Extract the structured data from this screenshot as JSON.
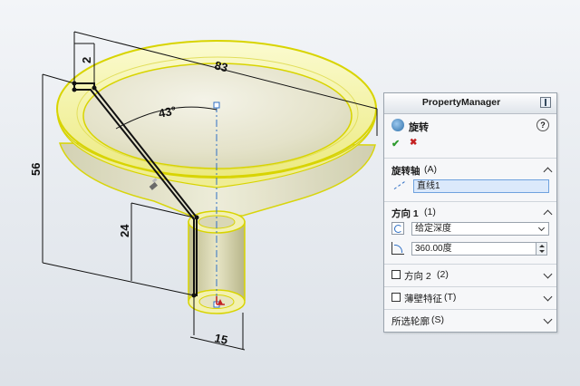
{
  "dimensions": {
    "flange_thickness": "2",
    "top_diameter": "83",
    "cone_angle": "43°",
    "total_height": "56",
    "stem_length": "24",
    "stem_diameter": "15"
  },
  "property_manager": {
    "title": "PropertyManager",
    "feature_title": "旋转",
    "help_icon": "?",
    "ok_icon": "✔",
    "cancel_icon": "✖",
    "axis_section": {
      "label": "旋转轴",
      "shortcut": "(A)",
      "value": "直线1"
    },
    "direction1": {
      "label": "方向 1",
      "shortcut": "(1)",
      "end_condition": "给定深度",
      "angle_value": "360.00度"
    },
    "direction2": {
      "label": "方向 2",
      "shortcut": "(2)",
      "checked": false
    },
    "thin_feature": {
      "label": "薄壁特征",
      "shortcut": "(T)",
      "checked": false
    },
    "selected_contours": {
      "label": "所选轮廓",
      "shortcut": "(S)"
    }
  },
  "colors": {
    "model_fill": "#f3f19a",
    "model_edge": "#d8d400",
    "sketch_line": "#111111",
    "axis_line": "#2f6fc4",
    "accept_green": "#2e9b2e",
    "cancel_red": "#c42222",
    "field_highlight": "#dbe9fb"
  }
}
